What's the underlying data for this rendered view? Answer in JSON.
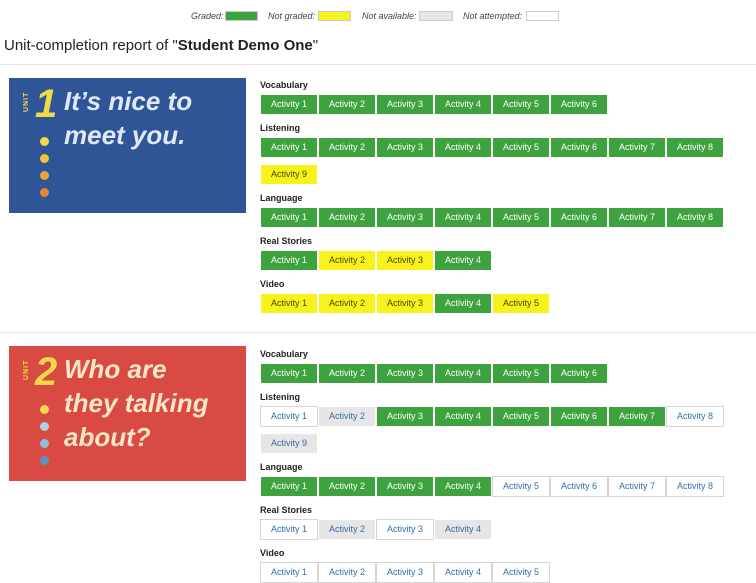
{
  "legend": [
    {
      "label": "Graded:",
      "color": "#3ea33e"
    },
    {
      "label": "Not graded:",
      "color": "#f7f21b"
    },
    {
      "label": "Not available:",
      "color": "#e6e6e6"
    },
    {
      "label": "Not attempted:",
      "color": "#ffffff"
    }
  ],
  "report": {
    "title_prefix": "Unit-completion report of \"",
    "student_name": "Student Demo One",
    "title_suffix": "\""
  },
  "units": [
    {
      "unit_word": "UNIT",
      "number": "1",
      "banner_text": "It’s nice to\nmeet you.",
      "background": "#2f5596",
      "text_color": "#dfe9f6",
      "dot_colors": [
        "#f3d94a",
        "#f3c13a",
        "#f0a23a",
        "#ea8238"
      ],
      "sections": [
        {
          "name": "Vocabulary",
          "activities": [
            {
              "label": "Activity 1",
              "status": "graded"
            },
            {
              "label": "Activity 2",
              "status": "graded"
            },
            {
              "label": "Activity 3",
              "status": "graded"
            },
            {
              "label": "Activity 4",
              "status": "graded"
            },
            {
              "label": "Activity 5",
              "status": "graded"
            },
            {
              "label": "Activity 6",
              "status": "graded"
            }
          ]
        },
        {
          "name": "Listening",
          "activities": [
            {
              "label": "Activity 1",
              "status": "graded"
            },
            {
              "label": "Activity 2",
              "status": "graded"
            },
            {
              "label": "Activity 3",
              "status": "graded"
            },
            {
              "label": "Activity 4",
              "status": "graded"
            },
            {
              "label": "Activity 5",
              "status": "graded"
            },
            {
              "label": "Activity 6",
              "status": "graded"
            },
            {
              "label": "Activity 7",
              "status": "graded"
            },
            {
              "label": "Activity 8",
              "status": "graded"
            },
            {
              "label": "Activity 9",
              "status": "notgraded"
            }
          ]
        },
        {
          "name": "Language",
          "activities": [
            {
              "label": "Activity 1",
              "status": "graded"
            },
            {
              "label": "Activity 2",
              "status": "graded"
            },
            {
              "label": "Activity 3",
              "status": "graded"
            },
            {
              "label": "Activity 4",
              "status": "graded"
            },
            {
              "label": "Activity 5",
              "status": "graded"
            },
            {
              "label": "Activity 6",
              "status": "graded"
            },
            {
              "label": "Activity 7",
              "status": "graded"
            },
            {
              "label": "Activity 8",
              "status": "graded"
            }
          ]
        },
        {
          "name": "Real Stories",
          "activities": [
            {
              "label": "Activity 1",
              "status": "graded"
            },
            {
              "label": "Activity 2",
              "status": "notgraded"
            },
            {
              "label": "Activity 3",
              "status": "notgraded"
            },
            {
              "label": "Activity 4",
              "status": "graded"
            }
          ]
        },
        {
          "name": "Video",
          "activities": [
            {
              "label": "Activity 1",
              "status": "notgraded"
            },
            {
              "label": "Activity 2",
              "status": "notgraded"
            },
            {
              "label": "Activity 3",
              "status": "notgraded"
            },
            {
              "label": "Activity 4",
              "status": "graded"
            },
            {
              "label": "Activity 5",
              "status": "notgraded"
            }
          ]
        }
      ]
    },
    {
      "unit_word": "UNIT",
      "number": "2",
      "banner_text": "Who are\nthey talking\nabout?",
      "background": "#d94a43",
      "text_color": "#f5e6c8",
      "dot_colors": [
        "#f3d94a",
        "#a9d0e3",
        "#8ebfdc",
        "#5f8fc9"
      ],
      "sections": [
        {
          "name": "Vocabulary",
          "activities": [
            {
              "label": "Activity 1",
              "status": "graded"
            },
            {
              "label": "Activity 2",
              "status": "graded"
            },
            {
              "label": "Activity 3",
              "status": "graded"
            },
            {
              "label": "Activity 4",
              "status": "graded"
            },
            {
              "label": "Activity 5",
              "status": "graded"
            },
            {
              "label": "Activity 6",
              "status": "graded"
            }
          ]
        },
        {
          "name": "Listening",
          "activities": [
            {
              "label": "Activity 1",
              "status": "notatt"
            },
            {
              "label": "Activity 2",
              "status": "na"
            },
            {
              "label": "Activity 3",
              "status": "graded"
            },
            {
              "label": "Activity 4",
              "status": "graded"
            },
            {
              "label": "Activity 5",
              "status": "graded"
            },
            {
              "label": "Activity 6",
              "status": "graded"
            },
            {
              "label": "Activity 7",
              "status": "graded"
            },
            {
              "label": "Activity 8",
              "status": "notatt"
            },
            {
              "label": "Activity 9",
              "status": "na"
            }
          ]
        },
        {
          "name": "Language",
          "activities": [
            {
              "label": "Activity 1",
              "status": "graded"
            },
            {
              "label": "Activity 2",
              "status": "graded"
            },
            {
              "label": "Activity 3",
              "status": "graded"
            },
            {
              "label": "Activity 4",
              "status": "graded"
            },
            {
              "label": "Activity 5",
              "status": "notatt"
            },
            {
              "label": "Activity 6",
              "status": "notatt"
            },
            {
              "label": "Activity 7",
              "status": "notatt"
            },
            {
              "label": "Activity 8",
              "status": "notatt"
            }
          ]
        },
        {
          "name": "Real Stories",
          "activities": [
            {
              "label": "Activity 1",
              "status": "notatt"
            },
            {
              "label": "Activity 2",
              "status": "na"
            },
            {
              "label": "Activity 3",
              "status": "notatt"
            },
            {
              "label": "Activity 4",
              "status": "na"
            }
          ]
        },
        {
          "name": "Video",
          "activities": [
            {
              "label": "Activity 1",
              "status": "notatt"
            },
            {
              "label": "Activity 2",
              "status": "notatt"
            },
            {
              "label": "Activity 3",
              "status": "notatt"
            },
            {
              "label": "Activity 4",
              "status": "notatt"
            },
            {
              "label": "Activity 5",
              "status": "notatt"
            }
          ]
        }
      ]
    }
  ]
}
